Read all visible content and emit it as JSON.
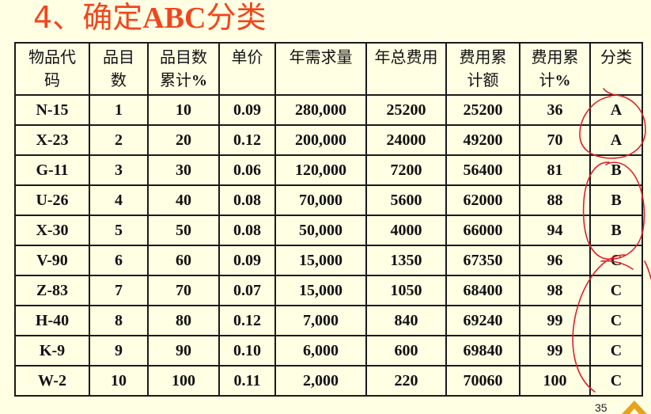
{
  "slide": {
    "title_number": "4、",
    "title_prefix": "确定",
    "title_abc": "ABC",
    "title_suffix": "分类",
    "page_number": "35"
  },
  "table": {
    "headers": [
      {
        "line1": "物品代",
        "line2": "码",
        "pct": ""
      },
      {
        "line1": "品目",
        "line2": "数",
        "pct": ""
      },
      {
        "line1": "品目数",
        "line2": "累计",
        "pct": "%"
      },
      {
        "line1": "单价",
        "line2": "",
        "pct": ""
      },
      {
        "line1": "年需求量",
        "line2": "",
        "pct": ""
      },
      {
        "line1": "年总费用",
        "line2": "",
        "pct": ""
      },
      {
        "line1": "费用累",
        "line2": "计额",
        "pct": ""
      },
      {
        "line1": "费用累",
        "line2": "计",
        "pct": "%"
      },
      {
        "line1": "分类",
        "line2": "",
        "pct": ""
      }
    ],
    "rows": [
      [
        "N-15",
        "1",
        "10",
        "0.09",
        "280,000",
        "25200",
        "25200",
        "36",
        "A"
      ],
      [
        "X-23",
        "2",
        "20",
        "0.12",
        "200,000",
        "24000",
        "49200",
        "70",
        "A"
      ],
      [
        "G-11",
        "3",
        "30",
        "0.06",
        "120,000",
        "7200",
        "56400",
        "81",
        "B"
      ],
      [
        "U-26",
        "4",
        "40",
        "0.08",
        "70,000",
        "5600",
        "62000",
        "88",
        "B"
      ],
      [
        "X-30",
        "5",
        "50",
        "0.08",
        "50,000",
        "4000",
        "66000",
        "94",
        "B"
      ],
      [
        "V-90",
        "6",
        "60",
        "0.09",
        "15,000",
        "1350",
        "67350",
        "96",
        "C"
      ],
      [
        "Z-83",
        "7",
        "70",
        "0.07",
        "15,000",
        "1050",
        "68400",
        "98",
        "C"
      ],
      [
        "H-40",
        "8",
        "80",
        "0.12",
        "7,000",
        "840",
        "69240",
        "99",
        "C"
      ],
      [
        "K-9",
        "9",
        "90",
        "0.10",
        "6,000",
        "600",
        "69840",
        "99",
        "C"
      ],
      [
        "W-2",
        "10",
        "100",
        "0.11",
        "2,000",
        "220",
        "70060",
        "100",
        "C"
      ]
    ]
  },
  "colors": {
    "background": "#FFFFE4",
    "title": "#F0461E",
    "annotation": "#E0202A",
    "corner": "#E8A21A"
  }
}
